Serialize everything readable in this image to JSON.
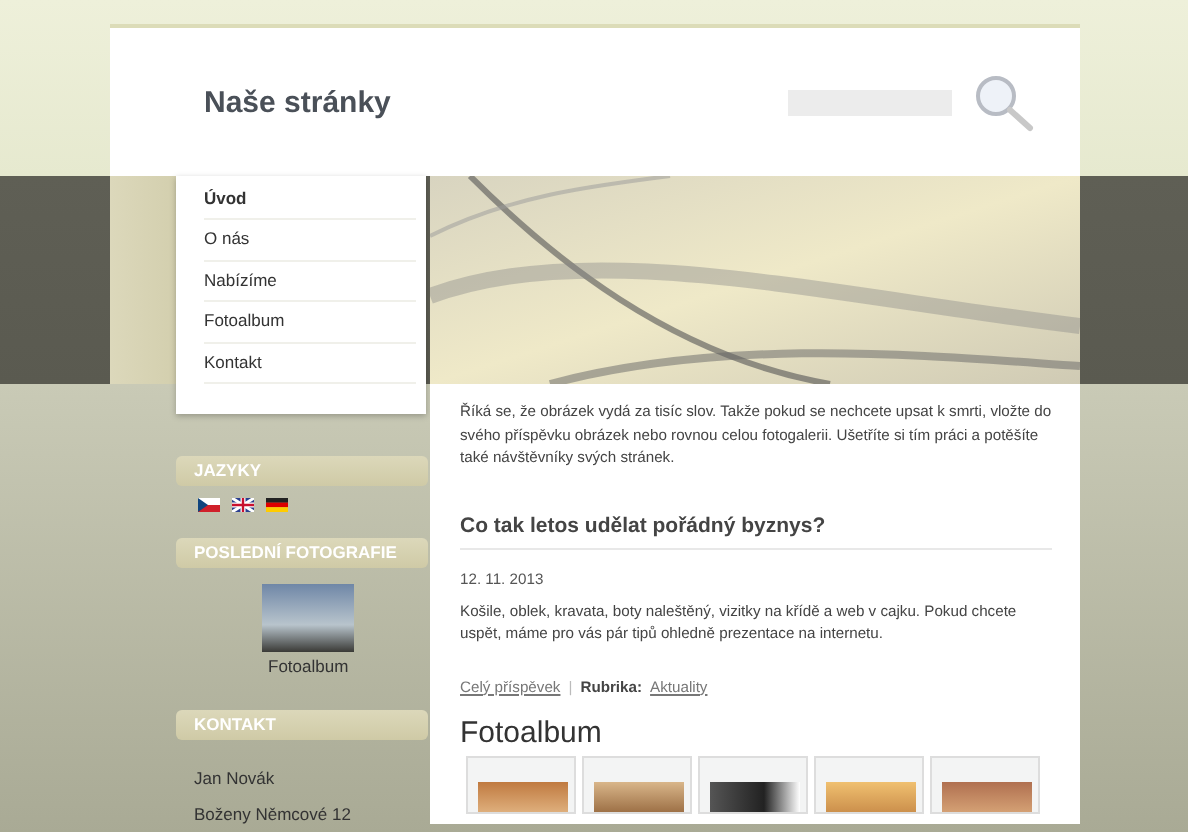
{
  "site_title": "Naše stránky",
  "nav": [
    {
      "label": "Úvod",
      "selected": true
    },
    {
      "label": "O nás",
      "selected": false
    },
    {
      "label": "Nabízíme",
      "selected": false
    },
    {
      "label": "Fotoalbum",
      "selected": false
    },
    {
      "label": "Kontakt",
      "selected": false
    }
  ],
  "sidebar": {
    "languages": {
      "heading": "JAZYKY",
      "flags": [
        {
          "kind": "cz"
        },
        {
          "kind": "gb"
        },
        {
          "kind": "de"
        }
      ]
    },
    "latest_photos": {
      "heading": "POSLEDNÍ FOTOGRAFIE",
      "caption": "Fotoalbum"
    },
    "contact": {
      "heading": "KONTAKT",
      "lines": [
        "Jan Novák",
        "Boženy Němcové 12"
      ]
    }
  },
  "intro": "Říká se, že obrázek vydá za tisíc slov. Takže pokud se nechcete upsat k smrti, vložte do svého příspěvku obrázek nebo rovnou celou fotogalerii. Ušetříte si tím práci a potěšíte také návštěvníky svých stránek.",
  "article": {
    "title": "Co tak letos udělat pořádný byznys?",
    "date": "12. 11. 2013",
    "excerpt": "Košile, oblek, kravata, boty naleštěný, vizitky na křídě a web v cajku. Pokud chcete uspět, máme pro vás pár tipů ohledně prezentace na internetu.",
    "more_link": "Celý příspěvek",
    "separator": "|",
    "category_label": "Rubrika:",
    "category": "Aktuality"
  },
  "gallery": {
    "heading": "Fotoalbum"
  }
}
